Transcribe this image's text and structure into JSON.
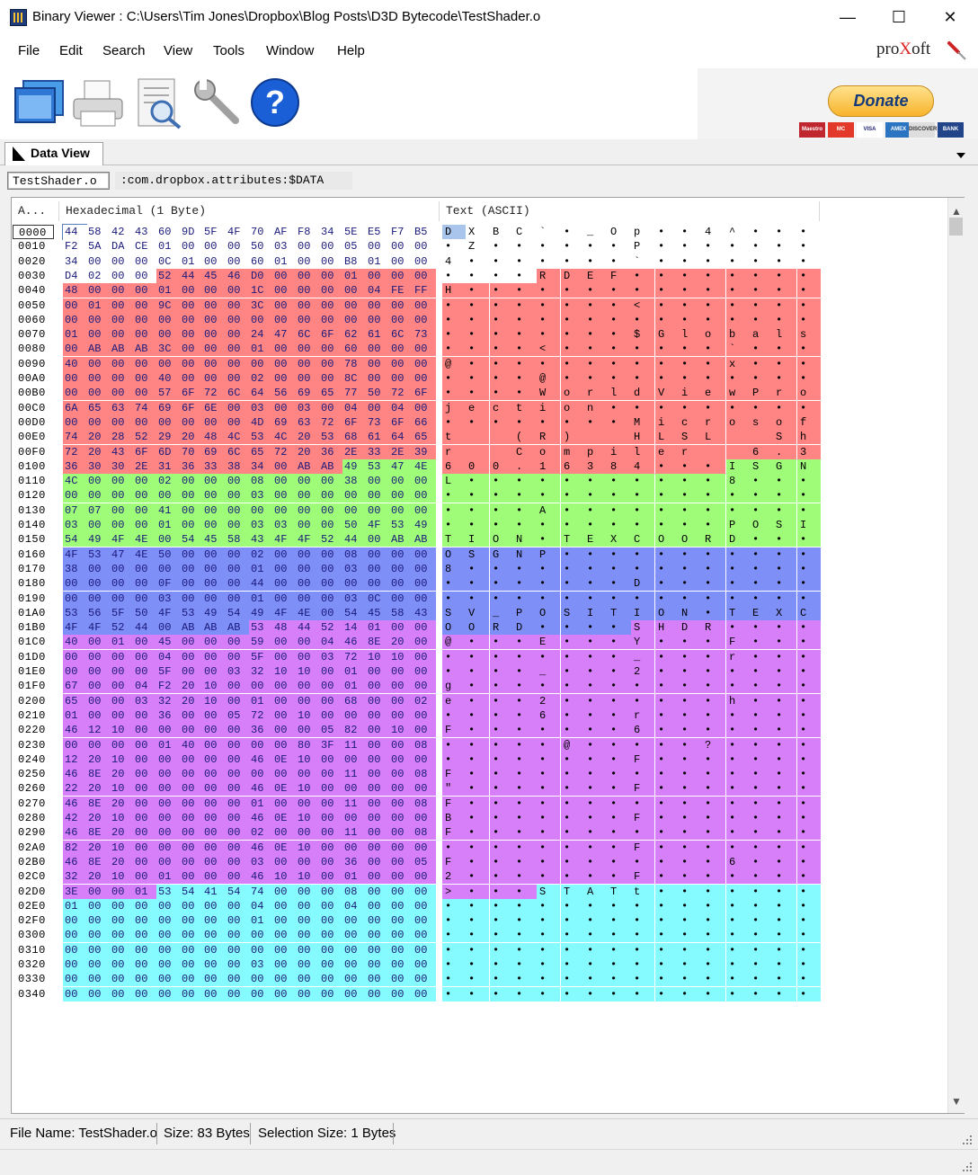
{
  "window": {
    "title": "Binary Viewer : C:\\Users\\Tim Jones\\Dropbox\\Blog Posts\\D3D Bytecode\\TestShader.o",
    "minimize": "—",
    "maximize": "☐",
    "close": "✕"
  },
  "menu": [
    "File",
    "Edit",
    "Search",
    "View",
    "Tools",
    "Window",
    "Help"
  ],
  "brand": {
    "pre": "pro",
    "x": "X",
    "post": "oft"
  },
  "toolbar": {
    "icons": [
      "open-file-icon",
      "print-icon",
      "print-preview-icon",
      "settings-wrench-icon",
      "help-icon"
    ],
    "donate_label": "Donate",
    "cards": [
      "Maestro",
      "MC",
      "VISA",
      "AMEX",
      "DISCOVER",
      "BANK"
    ],
    "card_colors": [
      "#c0262e",
      "#e2392a",
      "#ffffff",
      "#2b74c2",
      "#dedede",
      "#224488"
    ]
  },
  "tabs": {
    "main": "Data View",
    "file_tab": "TestShader.o",
    "stream_tab": ":com.dropbox.attributes:$DATA"
  },
  "columns": {
    "address": "A...",
    "hex": "Hexadecimal (1 Byte)",
    "text": "Text (ASCII)"
  },
  "dump": {
    "rows": [
      {
        "addr": "0000",
        "hex": "44 58 42 43 60 9D 5F 4F 70 AF F8 34 5E E5 F7 B5",
        "text": "D X B C ` • _ O p • • 4 ^ • • •"
      },
      {
        "addr": "0010",
        "hex": "F2 5A DA CE 01 00 00 00 50 03 00 00 05 00 00 00",
        "text": "• Z • • • • • • P • • • • • • •"
      },
      {
        "addr": "0020",
        "hex": "34 00 00 00 0C 01 00 00 60 01 00 00 B8 01 00 00",
        "text": "4 • • • • • • • ` • • • • • • •"
      },
      {
        "addr": "0030",
        "hex": "D4 02 00 00 52 44 45 46 D0 00 00 00 01 00 00 00",
        "text": "• • • • R D E F • • • • • • • •"
      },
      {
        "addr": "0040",
        "hex": "48 00 00 00 01 00 00 00 1C 00 00 00 00 04 FE FF",
        "text": "H • • • • • • • • • • • • • • •"
      },
      {
        "addr": "0050",
        "hex": "00 01 00 00 9C 00 00 00 3C 00 00 00 00 00 00 00",
        "text": "• • • • • • • • < • • • • • • •"
      },
      {
        "addr": "0060",
        "hex": "00 00 00 00 00 00 00 00 00 00 00 00 00 00 00 00",
        "text": "• • • • • • • • • • • • • • • •"
      },
      {
        "addr": "0070",
        "hex": "01 00 00 00 00 00 00 00 24 47 6C 6F 62 61 6C 73",
        "text": "• • • • • • • • $ G l o b a l s"
      },
      {
        "addr": "0080",
        "hex": "00 AB AB AB 3C 00 00 00 01 00 00 00 60 00 00 00",
        "text": "• • • • < • • • • • • • ` • • •"
      },
      {
        "addr": "0090",
        "hex": "40 00 00 00 00 00 00 00 00 00 00 00 78 00 00 00",
        "text": "@ • • • • • • • • • • • x • • •"
      },
      {
        "addr": "00A0",
        "hex": "00 00 00 00 40 00 00 00 02 00 00 00 8C 00 00 00",
        "text": "• • • • @ • • • • • • • • • • •"
      },
      {
        "addr": "00B0",
        "hex": "00 00 00 00 57 6F 72 6C 64 56 69 65 77 50 72 6F",
        "text": "• • • • W o r l d V i e w P r o"
      },
      {
        "addr": "00C0",
        "hex": "6A 65 63 74 69 6F 6E 00 03 00 03 00 04 00 04 00",
        "text": "j e c t i o n • • • • • • • • •"
      },
      {
        "addr": "00D0",
        "hex": "00 00 00 00 00 00 00 00 4D 69 63 72 6F 73 6F 66",
        "text": "• • • • • • • • M i c r o s o f"
      },
      {
        "addr": "00E0",
        "hex": "74 20 28 52 29 20 48 4C 53 4C 20 53 68 61 64 65",
        "text": "t   ( R )   H L S L   S h a d e"
      },
      {
        "addr": "00F0",
        "hex": "72 20 43 6F 6D 70 69 6C 65 72 20 36 2E 33 2E 39",
        "text": "r   C o m p i l e r   6 . 3 . 9"
      },
      {
        "addr": "0100",
        "hex": "36 30 30 2E 31 36 33 38 34 00 AB AB 49 53 47 4E",
        "text": "6 0 0 . 1 6 3 8 4 • • • I S G N"
      },
      {
        "addr": "0110",
        "hex": "4C 00 00 00 02 00 00 00 08 00 00 00 38 00 00 00",
        "text": "L • • • • • • • • • • • 8 • • •"
      },
      {
        "addr": "0120",
        "hex": "00 00 00 00 00 00 00 00 03 00 00 00 00 00 00 00",
        "text": "• • • • • • • • • • • • • • • •"
      },
      {
        "addr": "0130",
        "hex": "07 07 00 00 41 00 00 00 00 00 00 00 00 00 00 00",
        "text": "• • • • A • • • • • • • • • • •"
      },
      {
        "addr": "0140",
        "hex": "03 00 00 00 01 00 00 00 03 03 00 00 50 4F 53 49",
        "text": "• • • • • • • • • • • • P O S I"
      },
      {
        "addr": "0150",
        "hex": "54 49 4F 4E 00 54 45 58 43 4F 4F 52 44 00 AB AB",
        "text": "T I O N • T E X C O O R D • • •"
      },
      {
        "addr": "0160",
        "hex": "4F 53 47 4E 50 00 00 00 02 00 00 00 08 00 00 00",
        "text": "O S G N P • • • • • • • • • • •"
      },
      {
        "addr": "0170",
        "hex": "38 00 00 00 00 00 00 00 01 00 00 00 03 00 00 00",
        "text": "8 • • • • • • • • • • • • • • •"
      },
      {
        "addr": "0180",
        "hex": "00 00 00 00 0F 00 00 00 44 00 00 00 00 00 00 00",
        "text": "• • • • • • • • D • • • • • • •"
      },
      {
        "addr": "0190",
        "hex": "00 00 00 00 03 00 00 00 01 00 00 00 03 0C 00 00",
        "text": "• • • • • • • • • • • • • • • •"
      },
      {
        "addr": "01A0",
        "hex": "53 56 5F 50 4F 53 49 54 49 4F 4E 00 54 45 58 43",
        "text": "S V _ P O S I T I O N • T E X C"
      },
      {
        "addr": "01B0",
        "hex": "4F 4F 52 44 00 AB AB AB 53 48 44 52 14 01 00 00",
        "text": "O O R D • • • • S H D R • • • •"
      },
      {
        "addr": "01C0",
        "hex": "40 00 01 00 45 00 00 00 59 00 00 04 46 8E 20 00",
        "text": "@ • • • E • • • Y • • • F • • •"
      },
      {
        "addr": "01D0",
        "hex": "00 00 00 00 04 00 00 00 5F 00 00 03 72 10 10 00",
        "text": "• • • • • • • • _ • • • r • • •"
      },
      {
        "addr": "01E0",
        "hex": "00 00 00 00 5F 00 00 03 32 10 10 00 01 00 00 00",
        "text": "• • • • _ • • • 2 • • • • • • •"
      },
      {
        "addr": "01F0",
        "hex": "67 00 00 04 F2 20 10 00 00 00 00 00 01 00 00 00",
        "text": "g • • • • • • • • • • • • • • •"
      },
      {
        "addr": "0200",
        "hex": "65 00 00 03 32 20 10 00 01 00 00 00 68 00 00 02",
        "text": "e • • • 2 • • • • • • • h • • •"
      },
      {
        "addr": "0210",
        "hex": "01 00 00 00 36 00 00 05 72 00 10 00 00 00 00 00",
        "text": "• • • • 6 • • • r • • • • • • •"
      },
      {
        "addr": "0220",
        "hex": "46 12 10 00 00 00 00 00 36 00 00 05 82 00 10 00",
        "text": "F • • • • • • • 6 • • • • • • •"
      },
      {
        "addr": "0230",
        "hex": "00 00 00 00 01 40 00 00 00 00 80 3F 11 00 00 08",
        "text": "• • • • • @ • • • • • ? • • • •"
      },
      {
        "addr": "0240",
        "hex": "12 20 10 00 00 00 00 00 46 0E 10 00 00 00 00 00",
        "text": "• • • • • • • • F • • • • • • •"
      },
      {
        "addr": "0250",
        "hex": "46 8E 20 00 00 00 00 00 00 00 00 00 11 00 00 08",
        "text": "F • • • • • • • • • • • • • • •"
      },
      {
        "addr": "0260",
        "hex": "22 20 10 00 00 00 00 00 46 0E 10 00 00 00 00 00",
        "text": "\" • • • • • • • F • • • • • • •"
      },
      {
        "addr": "0270",
        "hex": "46 8E 20 00 00 00 00 00 01 00 00 00 11 00 00 08",
        "text": "F • • • • • • • • • • • • • • •"
      },
      {
        "addr": "0280",
        "hex": "42 20 10 00 00 00 00 00 46 0E 10 00 00 00 00 00",
        "text": "B • • • • • • • F • • • • • • •"
      },
      {
        "addr": "0290",
        "hex": "46 8E 20 00 00 00 00 00 02 00 00 00 11 00 00 08",
        "text": "F • • • • • • • • • • • • • • •"
      },
      {
        "addr": "02A0",
        "hex": "82 20 10 00 00 00 00 00 46 0E 10 00 00 00 00 00",
        "text": "• • • • • • • • F • • • • • • •"
      },
      {
        "addr": "02B0",
        "hex": "46 8E 20 00 00 00 00 00 03 00 00 00 36 00 00 05",
        "text": "F • • • • • • • • • • • 6 • • •"
      },
      {
        "addr": "02C0",
        "hex": "32 20 10 00 01 00 00 00 46 10 10 00 01 00 00 00",
        "text": "2 • • • • • • • F • • • • • • •"
      },
      {
        "addr": "02D0",
        "hex": "3E 00 00 01 53 54 41 54 74 00 00 00 08 00 00 00",
        "text": "> • • • S T A T t • • • • • • •"
      },
      {
        "addr": "02E0",
        "hex": "01 00 00 00 00 00 00 00 04 00 00 00 04 00 00 00",
        "text": "• • • • • • • • • • • • • • • •"
      },
      {
        "addr": "02F0",
        "hex": "00 00 00 00 00 00 00 00 01 00 00 00 00 00 00 00",
        "text": "• • • • • • • • • • • • • • • •"
      },
      {
        "addr": "0300",
        "hex": "00 00 00 00 00 00 00 00 00 00 00 00 00 00 00 00",
        "text": "• • • • • • • • • • • • • • • •"
      },
      {
        "addr": "0310",
        "hex": "00 00 00 00 00 00 00 00 00 00 00 00 00 00 00 00",
        "text": "• • • • • • • • • • • • • • • •"
      },
      {
        "addr": "0320",
        "hex": "00 00 00 00 00 00 00 00 03 00 00 00 00 00 00 00",
        "text": "• • • • • • • • • • • • • • • •"
      },
      {
        "addr": "0330",
        "hex": "00 00 00 00 00 00 00 00 00 00 00 00 00 00 00 00",
        "text": "• • • • • • • • • • • • • • • •"
      },
      {
        "addr": "0340",
        "hex": "00 00 00 00 00 00 00 00 00 00 00 00 00 00 00 00",
        "text": "• • • • • • • • • • • • • • • •"
      }
    ],
    "sections": [
      {
        "name": "DXBC header",
        "start": 0,
        "end": 51,
        "color": "#ffffff"
      },
      {
        "name": "RDEF",
        "start": 52,
        "end": 267,
        "color": "#ff8585"
      },
      {
        "name": "ISGN",
        "start": 268,
        "end": 351,
        "color": "#9efc79"
      },
      {
        "name": "OSGN",
        "start": 352,
        "end": 439,
        "color": "#7f8ff8"
      },
      {
        "name": "SHDR",
        "start": 440,
        "end": 723,
        "color": "#d77ff9"
      },
      {
        "name": "STAT",
        "start": 724,
        "end": 847,
        "color": "#85fbff"
      }
    ],
    "selected_offset": 0
  },
  "status": {
    "file_name": "File Name: TestShader.o",
    "size": "Size: 83 Bytes",
    "selection": "Selection Size: 1 Bytes"
  }
}
